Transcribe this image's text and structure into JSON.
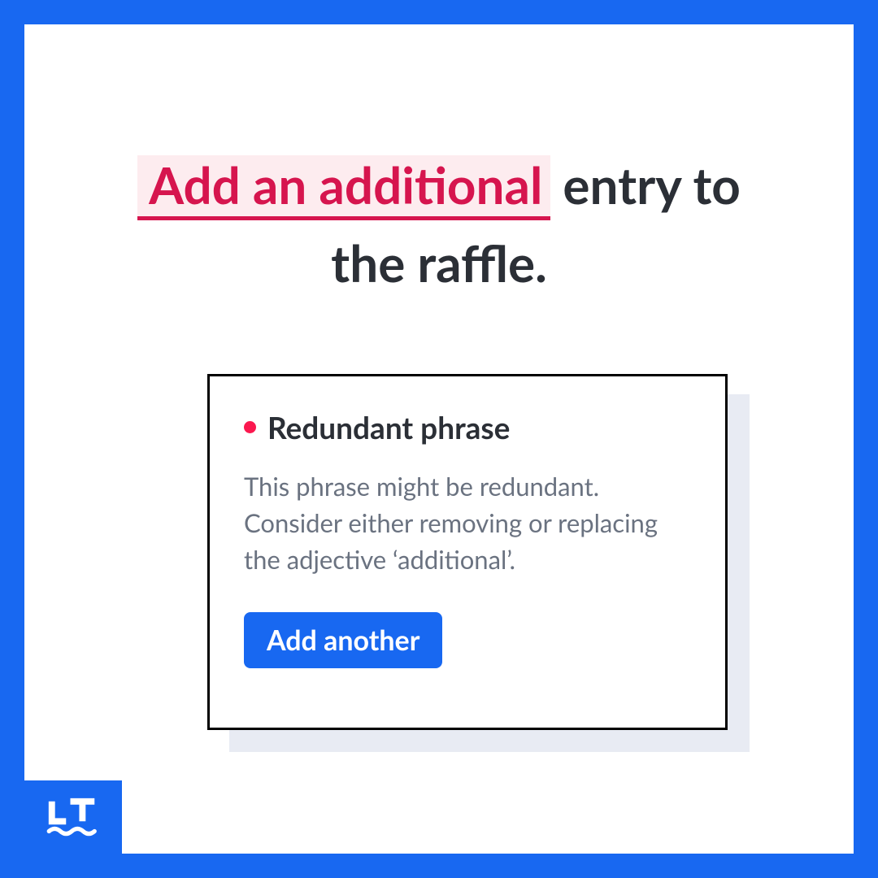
{
  "sentence": {
    "highlighted": "Add an additional",
    "rest": " entry to the raffle."
  },
  "card": {
    "title": "Redundant phrase",
    "description": "This phrase might be redundant. Consider either removing or replacing the adjective ‘additional’.",
    "suggestion": "Add another"
  },
  "colors": {
    "brand": "#1868f1",
    "error": "#d6154e",
    "dot": "#fb184f"
  }
}
